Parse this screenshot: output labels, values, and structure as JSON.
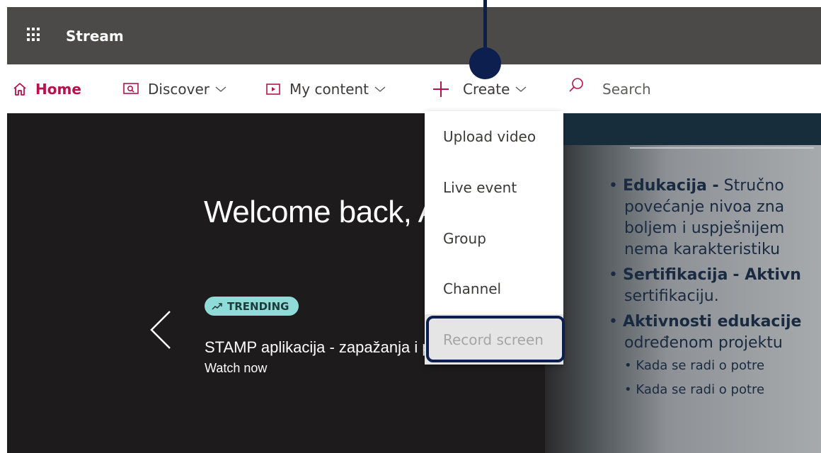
{
  "app": {
    "title": "Stream"
  },
  "nav": {
    "home": "Home",
    "discover": "Discover",
    "my_content": "My content",
    "create": "Create",
    "search": "Search"
  },
  "hero": {
    "welcome": "Welcome back, Adan",
    "badge": "TRENDING",
    "video_title": "STAMP aplikacija - zapažanja i promjene",
    "watch_now": "Watch now",
    "slide": {
      "l1b": "Edukacija -",
      "l1": "Stručno",
      "l2": "povećanje nivoa zna",
      "l3": "boljem i uspješnijem",
      "l4": "nema karakteristiku",
      "l5b": "Sertifikacija",
      "l5": "- Aktivn",
      "l6": "sertifikaciju.",
      "l7b": "Aktivnosti edukacije",
      "l8": "određenom projektu",
      "l9": "Kada se radi o potre",
      "l10": "Kada se radi o potre"
    }
  },
  "create_menu": {
    "items": [
      "Upload video",
      "Live event",
      "Group",
      "Channel",
      "Record screen"
    ]
  },
  "colors": {
    "suite_bar": "#4b4a48",
    "accent": "#b4144b",
    "badge": "#8fdbd8",
    "callout": "#0d1f4f"
  }
}
